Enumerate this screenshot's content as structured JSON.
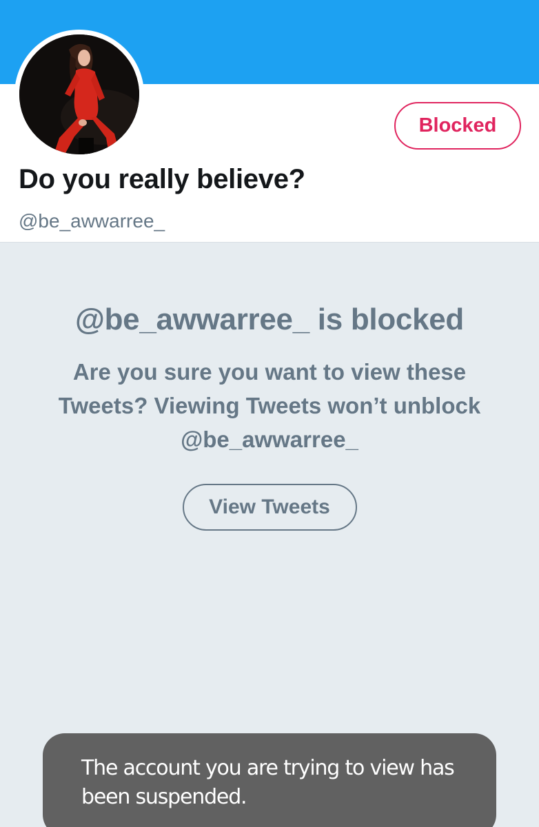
{
  "profile": {
    "display_name": "Do you really believe?",
    "handle": "@be_awwarree_",
    "blocked_button_label": "Blocked",
    "banner_color": "#1da1f2",
    "avatar_icon": "profile-photo"
  },
  "blocked_notice": {
    "title": "@be_awwarree_ is blocked",
    "message": "Are you sure you want to view these Tweets? Viewing Tweets won’t unblock @be_awwarree_",
    "view_button_label": "View Tweets"
  },
  "toast": {
    "message": "The account you are trying to view has been suspended."
  },
  "colors": {
    "accent_red": "#e0245e",
    "secondary_text": "#657786",
    "background": "#e6ecf0"
  }
}
